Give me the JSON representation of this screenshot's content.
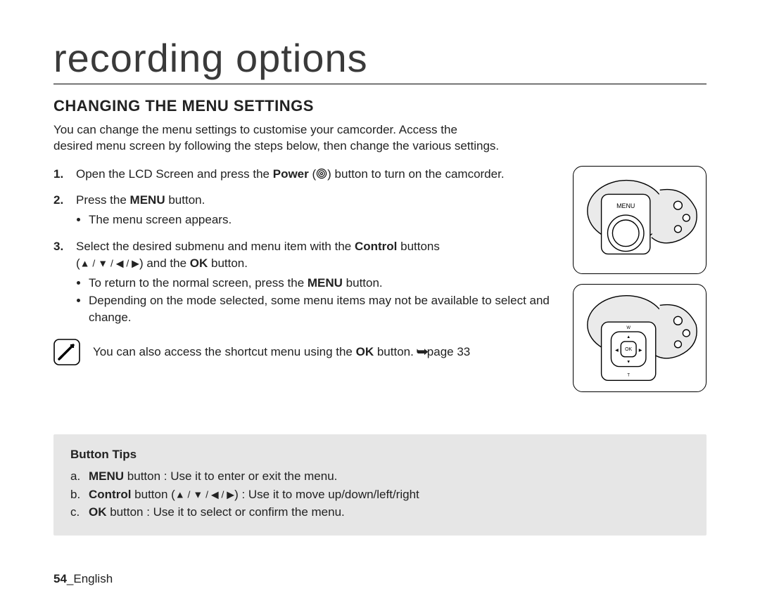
{
  "chapter_title": "recording options",
  "section_title": "CHANGING THE MENU SETTINGS",
  "intro_line1": "You can change the menu settings to customise your camcorder. Access the",
  "intro_line2": "desired menu screen by following the steps below, then change the various settings.",
  "step1_pre": "Open the LCD Screen and press the ",
  "step1_bold": "Power",
  "step1_post": " (",
  "step1_post2": ") button to turn on the camcorder.",
  "step2_pre": "Press the ",
  "step2_bold": "MENU",
  "step2_post": " button.",
  "step2_sub1": "The menu screen appears.",
  "step3_pre": "Select the desired submenu and menu item with the ",
  "step3_bold": "Control",
  "step3_post": " buttons",
  "step3_line2_pre": "(",
  "step3_line2_tris": "▲ / ▼ / ◀ / ▶",
  "step3_line2_mid": ") and the ",
  "step3_line2_bold": "OK",
  "step3_line2_post": " button.",
  "step3_sub1_pre": "To return to the normal screen, press the ",
  "step3_sub1_bold": "MENU",
  "step3_sub1_post": " button.",
  "step3_sub2": "Depending on the mode selected, some menu items may not be available to select and change.",
  "note_pre": "You can also access the shortcut menu using the ",
  "note_bold": "OK",
  "note_post": " button. ",
  "note_pageref": "page 33",
  "tips_title": "Button Tips",
  "tip_a_letter": "a.",
  "tip_a_bold": "MENU",
  "tip_a_text": " button : Use it to enter or exit the menu.",
  "tip_b_letter": "b.",
  "tip_b_bold": "Control",
  "tip_b_mid": " button (",
  "tip_b_tris": "▲ / ▼ / ◀ / ▶",
  "tip_b_post": ") : Use it to move up/down/left/right",
  "tip_c_letter": "c.",
  "tip_c_bold": "OK",
  "tip_c_text": " button : Use it to select or confirm the menu.",
  "page_number": "54",
  "page_lang_sep": "_",
  "page_lang": "English",
  "fig1_menu_label": "MENU",
  "fig2_ok_label": "OK",
  "fig2_w": "W",
  "fig2_t": "T"
}
